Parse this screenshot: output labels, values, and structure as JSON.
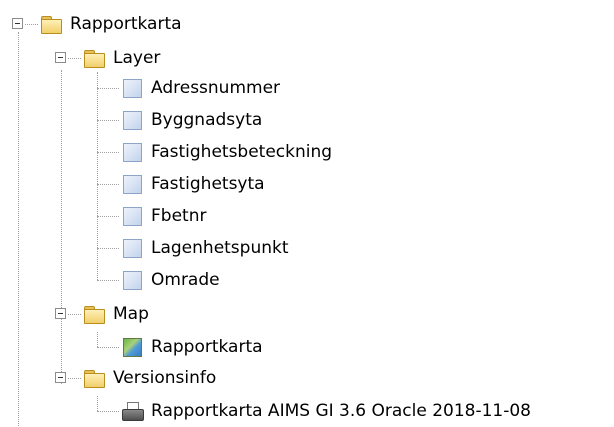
{
  "tree": {
    "root": {
      "label": "Rapportkarta",
      "icon": "folder-icon"
    },
    "groups": [
      {
        "label": "Layer",
        "icon": "folder-icon",
        "items": [
          {
            "label": "Adressnummer",
            "icon": "layer-icon"
          },
          {
            "label": "Byggnadsyta",
            "icon": "layer-icon"
          },
          {
            "label": "Fastighetsbeteckning",
            "icon": "layer-icon"
          },
          {
            "label": "Fastighetsyta",
            "icon": "layer-icon"
          },
          {
            "label": "Fbetnr",
            "icon": "layer-icon"
          },
          {
            "label": "Lagenhetspunkt",
            "icon": "layer-icon"
          },
          {
            "label": "Omrade",
            "icon": "layer-icon"
          }
        ]
      },
      {
        "label": "Map",
        "icon": "folder-icon",
        "items": [
          {
            "label": "Rapportkarta",
            "icon": "map-icon"
          }
        ]
      },
      {
        "label": "Versionsinfo",
        "icon": "folder-icon",
        "items": [
          {
            "label": "Rapportkarta AIMS GI 3.6 Oracle 2018-11-08",
            "icon": "printer-icon"
          }
        ]
      }
    ]
  }
}
